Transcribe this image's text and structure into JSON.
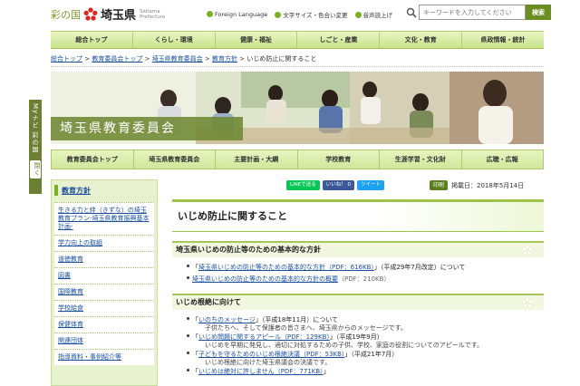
{
  "side_tab": {
    "label": "Myナビ 彩の国",
    "close": "閉く"
  },
  "header": {
    "nickname": "彩の国",
    "pref_name": "埼玉県",
    "roman": [
      "Saitama",
      "Prefecture"
    ],
    "util_links": [
      "Foreign Language",
      "文字サイズ・色合い変更",
      "音声読上げ"
    ],
    "search": {
      "placeholder": "キーワードを入力してください",
      "button": "検索"
    }
  },
  "global_nav": [
    "総合トップ",
    "くらし・環境",
    "健康・福祉",
    "しごと・産業",
    "文化・教育",
    "県政情報・統計"
  ],
  "breadcrumb": {
    "links": [
      "総合トップ",
      "教育委員会トップ",
      "埼玉県教育委員会",
      "教育方針"
    ],
    "current": "いじめ防止に関すること",
    "sep": ">"
  },
  "banner": {
    "title": "埼玉県教育委員会"
  },
  "section_nav": [
    "教育委員会トップ",
    "埼玉県教育委員会",
    "主要計画・大綱",
    "学校教育",
    "生涯学習・文化財",
    "広聴・広報"
  ],
  "sidebar": {
    "heading": "教育方針",
    "items": [
      "生きる力と絆（きずな）の埼玉教育プラン-埼玉県教育振興基本計画-",
      "学力向上の取組",
      "道徳教育",
      "図書",
      "国際教育",
      "学校給食",
      "保健体育",
      "関連団体",
      "指導資料・事例紹介等"
    ]
  },
  "share": {
    "line": "LINEで送る",
    "facebook": "いいね！ 0",
    "twitter": "ツイート"
  },
  "print": {
    "button": "印刷",
    "date": "掲載日：2018年5月14日"
  },
  "page": {
    "title": "いじめ防止に関すること",
    "sections": [
      {
        "heading": "埼玉県いじめの防止等のための基本的な方針",
        "items": [
          {
            "pre": "「",
            "link": "埼玉県いじめの防止等のための基本的な方針（PDF：616KB）",
            "post": "」（平成29年7月改定）について",
            "sub": ""
          },
          {
            "pre": "",
            "link": "埼玉県いじめの防止等のための基本的な方針の概要",
            "post": "（PDF：210KB）",
            "sub": ""
          }
        ]
      },
      {
        "heading": "いじめ根絶に向けて",
        "items": [
          {
            "pre": "「",
            "link": "いのちのメッセージ",
            "post": "」（平成18年11月）について",
            "sub": "子供たちへ、そして保護者の皆さまへ、埼玉県からのメッセージです。"
          },
          {
            "pre": "「",
            "link": "いじめ問題に関するアピール（PDF：129KB）",
            "post": "」（平成19年9月）",
            "sub": "いじめを早期に発見し、適切に対処するための子供、学校、家庭の役割についてのアピールです。"
          },
          {
            "pre": "「",
            "link": "子どもを守るためのいじめ根絶決議（PDF：53KB）",
            "post": "」（平成21年7月）",
            "sub": "いじめ根絶に向けた埼玉県議会の決議です。"
          },
          {
            "pre": "「",
            "link": "いじめは絶対に許しません（PDF：771KB）",
            "post": "」",
            "sub": ""
          }
        ]
      }
    ]
  }
}
